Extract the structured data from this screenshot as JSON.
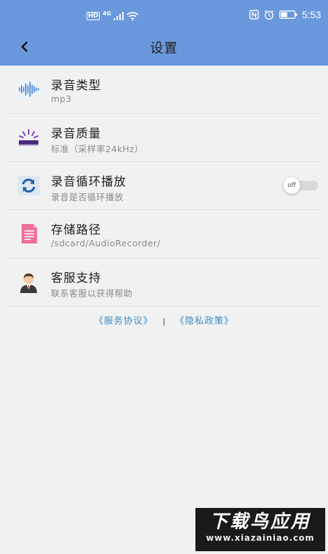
{
  "status_bar": {
    "hd": "HD",
    "network": "4G",
    "time": "5:53"
  },
  "header": {
    "title": "设置",
    "back_icon": "chevron-left-icon"
  },
  "settings": [
    {
      "title": "录音类型",
      "subtitle": "mp3",
      "icon": "waveform-icon"
    },
    {
      "title": "录音质量",
      "subtitle": "标准（采样率24kHz）",
      "icon": "quality-lamp-icon"
    },
    {
      "title": "录音循环播放",
      "subtitle": "录音是否循环播放",
      "icon": "loop-icon",
      "toggle": {
        "state": "off",
        "label": "off"
      }
    },
    {
      "title": "存储路径",
      "subtitle": "/sdcard/AudioRecorder/",
      "icon": "document-icon"
    },
    {
      "title": "客服支持",
      "subtitle": "联系客服以获得帮助",
      "icon": "support-agent-icon"
    }
  ],
  "footer_links": {
    "terms": "《服务协议》",
    "separator": "|",
    "privacy": "《隐私政策》"
  },
  "watermark": {
    "title": "下载鸟应用",
    "url": "www.xiazainiao.com"
  },
  "colors": {
    "header_bg": "#6a98dd",
    "link": "#3a8cc7",
    "page_bg": "#f1f1f1"
  }
}
